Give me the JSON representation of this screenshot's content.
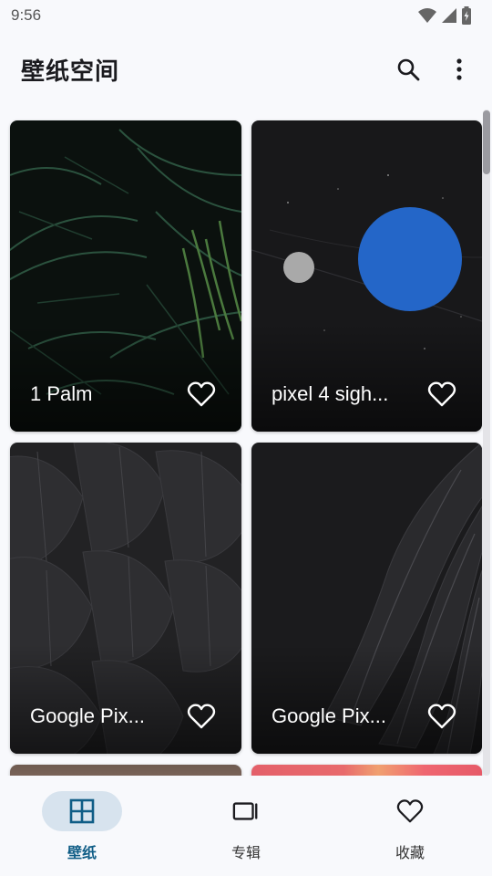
{
  "status_bar": {
    "time": "9:56",
    "icons": [
      "wifi-icon",
      "cellular-signal-icon",
      "battery-charging-icon"
    ]
  },
  "app_bar": {
    "title": "壁纸空间",
    "actions": [
      "search-icon",
      "more-vert-icon"
    ]
  },
  "wallpapers": [
    {
      "title": "1 Palm",
      "theme": "palm"
    },
    {
      "title": "pixel 4 sigh...",
      "theme": "planets"
    },
    {
      "title": "Google Pix...",
      "theme": "feathers"
    },
    {
      "title": "Google Pix...",
      "theme": "wing"
    }
  ],
  "bottom_nav": {
    "items": [
      {
        "label": "壁纸",
        "icon": "grid-icon",
        "active": true
      },
      {
        "label": "专辑",
        "icon": "album-icon",
        "active": false
      },
      {
        "label": "收藏",
        "icon": "heart-icon",
        "active": false
      }
    ]
  },
  "colors": {
    "background": "#f8f9fc",
    "accent": "#0f5d86",
    "nav_indicator": "#d7e3ee",
    "planet_blue": "#2466c8"
  }
}
